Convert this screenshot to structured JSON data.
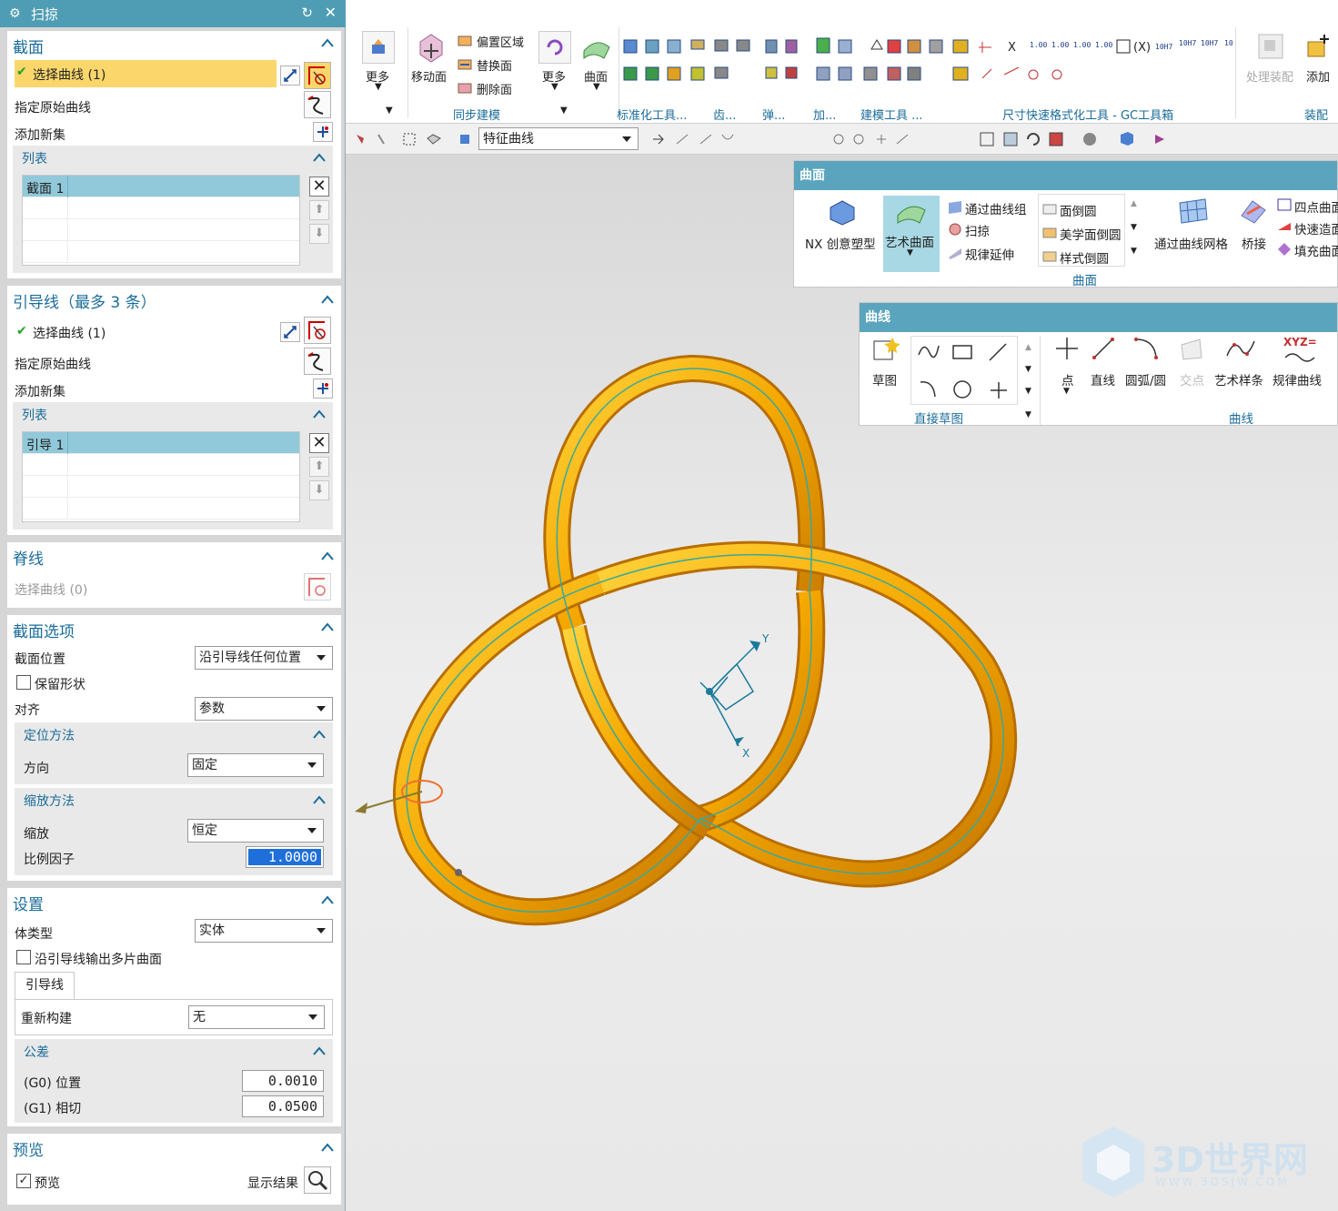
{
  "dialog": {
    "title": "扫掠",
    "section": {
      "header": "截面",
      "select_curve": "选择曲线 (1)",
      "specify_original": "指定原始曲线",
      "add_new_set": "添加新集",
      "list_header": "列表",
      "row1": "截面 1"
    },
    "guide": {
      "header": "引导线（最多 3 条）",
      "select_curve": "选择曲线 (1)",
      "specify_original": "指定原始曲线",
      "add_new_set": "添加新集",
      "list_header": "列表",
      "row1": "引导 1"
    },
    "spine": {
      "header": "脊线",
      "select_curve": "选择曲线 (0)"
    },
    "section_options": {
      "header": "截面选项",
      "position_label": "截面位置",
      "position_value": "沿引导线任何位置",
      "keep_shape": "保留形状",
      "align_label": "对齐",
      "align_value": "参数",
      "orientation": {
        "header": "定位方法",
        "direction_label": "方向",
        "direction_value": "固定"
      },
      "scaling": {
        "header": "缩放方法",
        "scale_label": "缩放",
        "scale_value": "恒定",
        "factor_label": "比例因子",
        "factor_value": "1.0000"
      }
    },
    "settings": {
      "header": "设置",
      "body_type_label": "体类型",
      "body_type_value": "实体",
      "multi_face": "沿引导线输出多片曲面",
      "tab": "引导线",
      "rebuild_label": "重新构建",
      "rebuild_value": "无",
      "tolerance": {
        "header": "公差",
        "g0_label": "(G0) 位置",
        "g0_value": "0.0010",
        "g1_label": "(G1) 相切",
        "g1_value": "0.0500"
      }
    },
    "preview": {
      "header": "预览",
      "preview_label": "预览",
      "show_result": "显示结果"
    }
  },
  "ribbon": {
    "more1": "更多",
    "move_face": "移动面",
    "offset_region": "偏置区域",
    "replace_face": "替换面",
    "delete_face": "删除面",
    "more2": "更多",
    "surface": "曲面",
    "group_sync": "同步建模",
    "group_std": "标准化工具...",
    "group_gear": "齿...",
    "group_spring": "弹...",
    "group_add": "加...",
    "group_build": "建模工具 ...",
    "group_dim": "尺寸快速格式化工具 - GC工具箱",
    "group_asm": "装配",
    "handle_asm": "处理装配",
    "add": "添加"
  },
  "selbar": {
    "filter": "特征曲线"
  },
  "surface_popup": {
    "title": "曲面",
    "nx": "NX 创意塑型",
    "art": "艺术曲面",
    "through_curves": "通过曲线组",
    "sweep": "扫掠",
    "ruled_ext": "规律延伸",
    "face_blend": "面倒圆",
    "aesthetic_blend": "美学面倒圆",
    "style_blend": "样式倒圆",
    "through_mesh": "通过曲线网格",
    "bridge": "桥接",
    "four_point": "四点曲面",
    "quick": "快速造面",
    "fill": "填充曲面",
    "group": "曲面"
  },
  "curve_popup": {
    "title": "曲线",
    "sketch": "草图",
    "direct_sketch": "直接草图",
    "point": "点",
    "line": "直线",
    "arc": "圆弧/圆",
    "intersect": "交点",
    "studio_spline": "艺术样条",
    "law_curve": "规律曲线",
    "xyz": "XYZ=",
    "group": "曲线"
  },
  "watermark": {
    "brand": "3D世界网",
    "url": "WWW.3DSJW.COM"
  },
  "csys": {
    "x": "X",
    "y": "Y"
  },
  "colors": {
    "title_bar": "#4f9db4",
    "selected_row": "#fbd76b",
    "list_selection": "#91c9db",
    "knot": "#f2a100",
    "accent_text": "#1a6c9a"
  }
}
